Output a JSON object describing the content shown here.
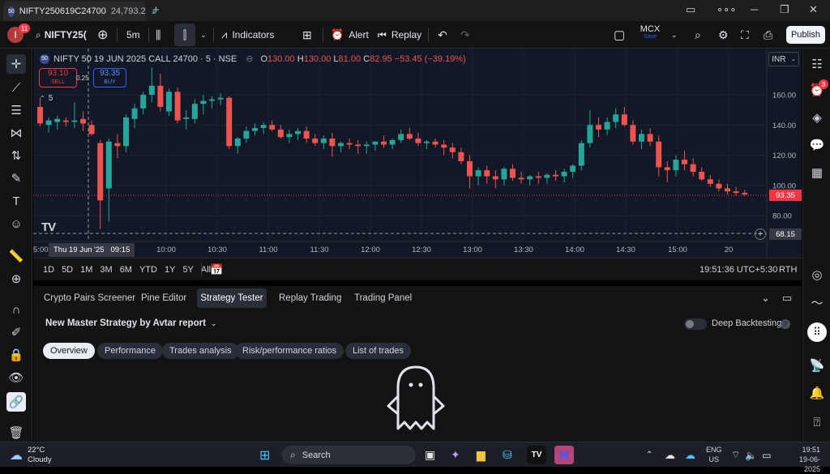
{
  "titlebar": {
    "tab_badge": "50",
    "tab_title": "NIFTY250619C24700",
    "tab_price": "24,793.2",
    "new_tab": "+"
  },
  "toolbar": {
    "avatar_letter": "I",
    "avatar_badge": "11",
    "symbol": "NIFTY25(",
    "interval": "5m",
    "indicators_label": "Indicators",
    "alert_label": "Alert",
    "replay_label": "Replay",
    "mcx_label": "MCX",
    "mcx_sub": "Save",
    "publish_label": "Publish"
  },
  "chart": {
    "legend_badge": "50",
    "legend_title": "NIFTY 50 19 JUN 2025 CALL 24700 · 5 · NSE",
    "ohlc": {
      "o_l": "O",
      "o": "130.00",
      "h_l": "H",
      "h": "130.00",
      "l_l": "L",
      "l": "81.00",
      "c_l": "C",
      "c": "82.95",
      "chg": "−53.45 (−39.19%)"
    },
    "sell_price": "93.10",
    "sell_label": "SELL",
    "spread": "0.25",
    "buy_price": "93.35",
    "buy_label": "BUY",
    "collapse_count": "5",
    "currency": "INR",
    "last_price_label": "93.35",
    "cross_price_label": "68.15",
    "logo": "TV",
    "cross_time_label": "Thu 19 Jun '25   09:15"
  },
  "chart_data": {
    "type": "candlestick",
    "y_ticks": [
      "160.00",
      "140.00",
      "120.00",
      "100.00",
      "80.00"
    ],
    "x_ticks": [
      "5:00",
      "10:00",
      "10:30",
      "11:00",
      "11:30",
      "12:00",
      "12:30",
      "13:00",
      "13:30",
      "14:00",
      "14:30",
      "15:00",
      "20"
    ],
    "ylim": [
      60,
      180
    ],
    "last_price": 93.35,
    "crosshair_price": 68.15,
    "up_color": "#26a69a",
    "down_color": "#ef5350",
    "candles": [
      [
        152,
        158,
        139,
        141
      ],
      [
        140,
        145,
        135,
        143
      ],
      [
        142,
        146,
        137,
        144
      ],
      [
        143,
        145,
        139,
        142
      ],
      [
        142,
        155,
        138,
        143
      ],
      [
        144,
        149,
        136,
        141
      ],
      [
        140,
        143,
        133,
        134
      ],
      [
        128,
        130,
        71,
        90
      ],
      [
        98,
        131,
        76,
        129
      ],
      [
        128,
        134,
        118,
        126
      ],
      [
        126,
        147,
        122,
        145
      ],
      [
        144,
        154,
        138,
        151
      ],
      [
        151,
        162,
        147,
        160
      ],
      [
        160,
        178,
        155,
        166
      ],
      [
        166,
        174,
        149,
        152
      ],
      [
        149,
        164,
        146,
        162
      ],
      [
        162,
        165,
        141,
        143
      ],
      [
        144,
        150,
        137,
        145
      ],
      [
        144,
        157,
        141,
        154
      ],
      [
        154,
        160,
        147,
        156
      ],
      [
        156,
        159,
        151,
        157
      ],
      [
        157,
        161,
        153,
        158
      ],
      [
        158,
        159,
        124,
        126
      ],
      [
        126,
        132,
        121,
        131
      ],
      [
        131,
        139,
        128,
        136
      ],
      [
        136,
        141,
        133,
        138
      ],
      [
        138,
        142,
        134,
        140
      ],
      [
        140,
        143,
        136,
        137
      ],
      [
        137,
        140,
        131,
        132
      ],
      [
        132,
        137,
        128,
        134
      ],
      [
        134,
        138,
        130,
        136
      ],
      [
        136,
        139,
        128,
        131
      ],
      [
        131,
        134,
        126,
        128
      ],
      [
        128,
        133,
        124,
        131
      ],
      [
        131,
        135,
        119,
        126
      ],
      [
        126,
        129,
        122,
        128
      ],
      [
        128,
        131,
        124,
        127
      ],
      [
        127,
        130,
        121,
        126
      ],
      [
        126,
        129,
        121,
        127
      ],
      [
        127,
        129,
        123,
        129
      ],
      [
        129,
        133,
        125,
        127
      ],
      [
        127,
        131,
        124,
        130
      ],
      [
        130,
        137,
        128,
        134
      ],
      [
        134,
        138,
        130,
        131
      ],
      [
        131,
        135,
        126,
        128
      ],
      [
        128,
        130,
        124,
        129
      ],
      [
        129,
        131,
        125,
        127
      ],
      [
        127,
        130,
        120,
        125
      ],
      [
        125,
        128,
        118,
        122
      ],
      [
        122,
        125,
        114,
        116
      ],
      [
        116,
        120,
        98,
        106
      ],
      [
        106,
        112,
        100,
        110
      ],
      [
        110,
        113,
        101,
        106
      ],
      [
        106,
        110,
        98,
        104
      ],
      [
        104,
        112,
        100,
        111
      ],
      [
        111,
        114,
        103,
        105
      ],
      [
        105,
        109,
        101,
        104
      ],
      [
        104,
        107,
        100,
        106
      ],
      [
        106,
        109,
        101,
        105
      ],
      [
        105,
        108,
        101,
        107
      ],
      [
        107,
        110,
        103,
        106
      ],
      [
        106,
        111,
        102,
        109
      ],
      [
        109,
        114,
        105,
        113
      ],
      [
        113,
        130,
        110,
        128
      ],
      [
        128,
        150,
        125,
        140
      ],
      [
        140,
        145,
        132,
        137
      ],
      [
        137,
        145,
        133,
        142
      ],
      [
        142,
        151,
        138,
        147
      ],
      [
        147,
        152,
        139,
        140
      ],
      [
        140,
        143,
        127,
        129
      ],
      [
        129,
        137,
        124,
        134
      ],
      [
        134,
        138,
        126,
        129
      ],
      [
        129,
        133,
        106,
        112
      ],
      [
        112,
        116,
        102,
        110
      ],
      [
        110,
        120,
        106,
        117
      ],
      [
        117,
        123,
        110,
        114
      ],
      [
        114,
        118,
        106,
        109
      ],
      [
        109,
        112,
        103,
        104
      ],
      [
        104,
        107,
        99,
        101
      ],
      [
        101,
        104,
        96,
        98
      ],
      [
        98,
        101,
        94,
        96
      ],
      [
        96,
        99,
        93,
        95
      ],
      [
        95,
        97,
        93,
        94
      ]
    ]
  },
  "timeframes": {
    "items": [
      "1D",
      "5D",
      "1M",
      "3M",
      "6M",
      "YTD",
      "1Y",
      "5Y",
      "All"
    ],
    "clock": "19:51:36 UTC+5:30",
    "rth": "RTH"
  },
  "panel": {
    "tabs": [
      "Crypto Pairs Screener",
      "Pine Editor",
      "Strategy Tester",
      "Replay Trading",
      "Trading Panel"
    ],
    "strategy_name": "New Master Strategy by Avtar report",
    "deep_backtesting": "Deep Backtesting",
    "subtabs": [
      "Overview",
      "Performance",
      "Trades analysis",
      "Risk/performance ratios",
      "List of trades"
    ]
  },
  "taskbar": {
    "temp": "22°C",
    "weather": "Cloudy",
    "search": "Search",
    "lang1": "ENG",
    "lang2": "US",
    "time": "19:51",
    "date": "19-06-2025"
  },
  "righttb": {
    "badge": "3"
  }
}
